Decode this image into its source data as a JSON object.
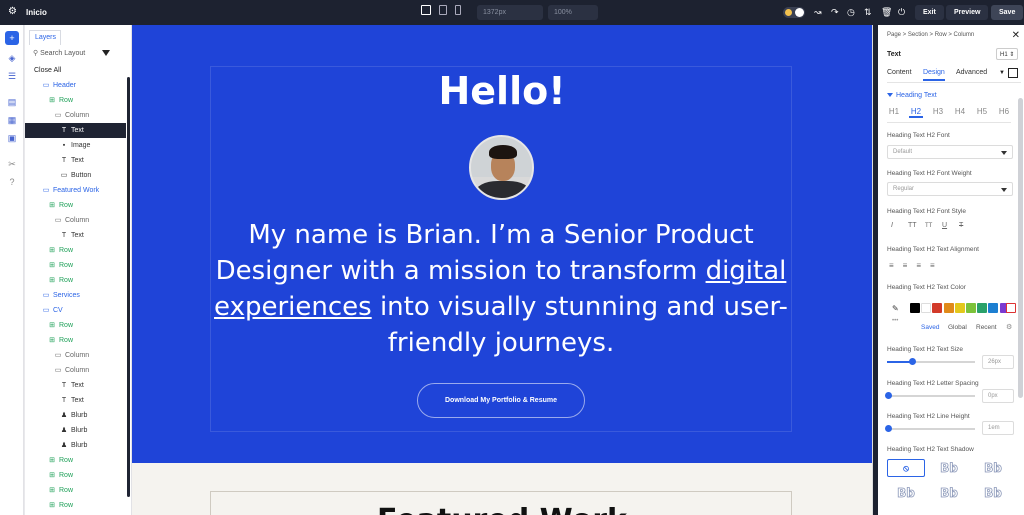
{
  "topbar": {
    "title": "Inicio",
    "width_value": "1372px",
    "zoom_value": "100%",
    "exit_label": "Exit",
    "preview_label": "Preview",
    "save_label": "Save"
  },
  "layers": {
    "tab_label": "Layers",
    "search_placeholder": "Search Layout",
    "close_all_label": "Close All",
    "items": [
      {
        "label": "Header",
        "type": "section"
      },
      {
        "label": "Row",
        "type": "row"
      },
      {
        "label": "Column",
        "type": "column"
      },
      {
        "label": "Text",
        "type": "text",
        "selected": true
      },
      {
        "label": "Image",
        "type": "image"
      },
      {
        "label": "Text",
        "type": "text"
      },
      {
        "label": "Button",
        "type": "button"
      },
      {
        "label": "Featured Work",
        "type": "section"
      },
      {
        "label": "Row",
        "type": "row"
      },
      {
        "label": "Column",
        "type": "column"
      },
      {
        "label": "Text",
        "type": "text"
      },
      {
        "label": "Row",
        "type": "row"
      },
      {
        "label": "Row",
        "type": "row"
      },
      {
        "label": "Row",
        "type": "row"
      },
      {
        "label": "Services",
        "type": "section"
      },
      {
        "label": "CV",
        "type": "section"
      },
      {
        "label": "Row",
        "type": "row"
      },
      {
        "label": "Row",
        "type": "row"
      },
      {
        "label": "Column",
        "type": "column"
      },
      {
        "label": "Column",
        "type": "column"
      },
      {
        "label": "Text",
        "type": "text"
      },
      {
        "label": "Text",
        "type": "text"
      },
      {
        "label": "Blurb",
        "type": "blurb"
      },
      {
        "label": "Blurb",
        "type": "blurb"
      },
      {
        "label": "Blurb",
        "type": "blurb"
      },
      {
        "label": "Row",
        "type": "row"
      },
      {
        "label": "Row",
        "type": "row"
      },
      {
        "label": "Row",
        "type": "row"
      },
      {
        "label": "Row",
        "type": "row"
      }
    ]
  },
  "canvas": {
    "hero_title": "Hello!",
    "hero_desc_part1": "My name is Brian. I’m a Senior Product Designer with a mission to transform ",
    "hero_desc_link": "digital experiences",
    "hero_desc_part2": " into visually stunning and user-friendly journeys.",
    "button_label": "Download My Portfolio & Resume",
    "next_section_title": "Featured Work",
    "hero_bg": "#1f44d8"
  },
  "settings": {
    "breadcrumb": "Page  >  Section  >  Row  >  Column",
    "module_title": "Text",
    "heading_level_badge": "H1 ⇕",
    "tabs": [
      "Content",
      "Design",
      "Advanced"
    ],
    "active_tab": "Design",
    "section_title": "Heading Text",
    "heading_levels": [
      "H1",
      "H2",
      "H3",
      "H4",
      "H5",
      "H6"
    ],
    "active_heading": "H2",
    "font_label": "Heading Text H2 Font",
    "font_value": "Default",
    "weight_label": "Heading Text H2 Font Weight",
    "weight_value": "Regular",
    "style_label": "Heading Text H2 Font Style",
    "style_options": [
      "I",
      "TT",
      "TT",
      "U",
      "T"
    ],
    "align_label": "Heading Text H2 Text Alignment",
    "color_label": "Heading Text H2 Text Color",
    "swatches": [
      "#000000",
      "#ffffff",
      "#d23a2a",
      "#e08a1a",
      "#e3c81c",
      "#7cc23a",
      "#2aa16a",
      "#1d7fd1",
      "#7a3ad1"
    ],
    "color_tabs": [
      "Saved",
      "Global",
      "Recent"
    ],
    "size_label": "Heading Text H2 Text Size",
    "size_value": "26px",
    "size_fraction": 0.27,
    "spacing_label": "Heading Text H2 Letter Spacing",
    "spacing_value": "0px",
    "spacing_fraction": 0.0,
    "lineheight_label": "Heading Text H2 Line Height",
    "lineheight_value": "1em",
    "lineheight_fraction": 0.0,
    "shadow_label": "Heading Text H2 Text Shadow",
    "shadow_cells": [
      "⦸",
      "Bb",
      "Bb",
      "Bb",
      "Bb",
      "Bb"
    ]
  }
}
